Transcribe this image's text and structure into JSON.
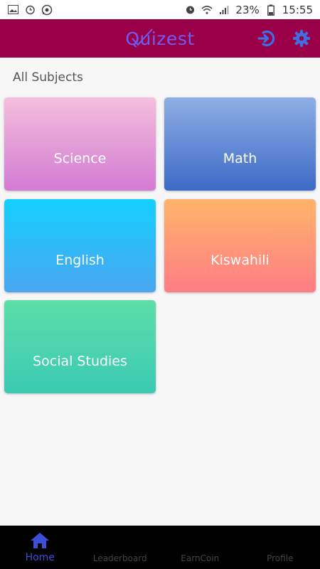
{
  "status_bar": {
    "battery_percent": "23%",
    "time": "15:55",
    "icons_left": [
      "image-icon",
      "alarm-icon",
      "whatsapp-icon"
    ],
    "icons_right": [
      "alarm-icon",
      "wifi-icon",
      "signal-icon",
      "battery-icon"
    ]
  },
  "app_bar": {
    "logo_text": "Quizest",
    "background": "#990047",
    "logo_color": "#6e5cf2",
    "actions": [
      "logout-icon",
      "settings-icon"
    ],
    "action_color": "#3d6fe3"
  },
  "main": {
    "section_title": "All Subjects",
    "subjects": [
      {
        "label": "Science"
      },
      {
        "label": "Math"
      },
      {
        "label": "English"
      },
      {
        "label": "Kiswahili"
      },
      {
        "label": "Social Studies"
      }
    ]
  },
  "bottom_nav": {
    "items": [
      {
        "label": "Home",
        "icon": "home-icon",
        "active": true
      },
      {
        "label": "Leaderboard"
      },
      {
        "label": "EarnCoin"
      },
      {
        "label": "Profile"
      }
    ],
    "active_color": "#3d4fd6"
  }
}
